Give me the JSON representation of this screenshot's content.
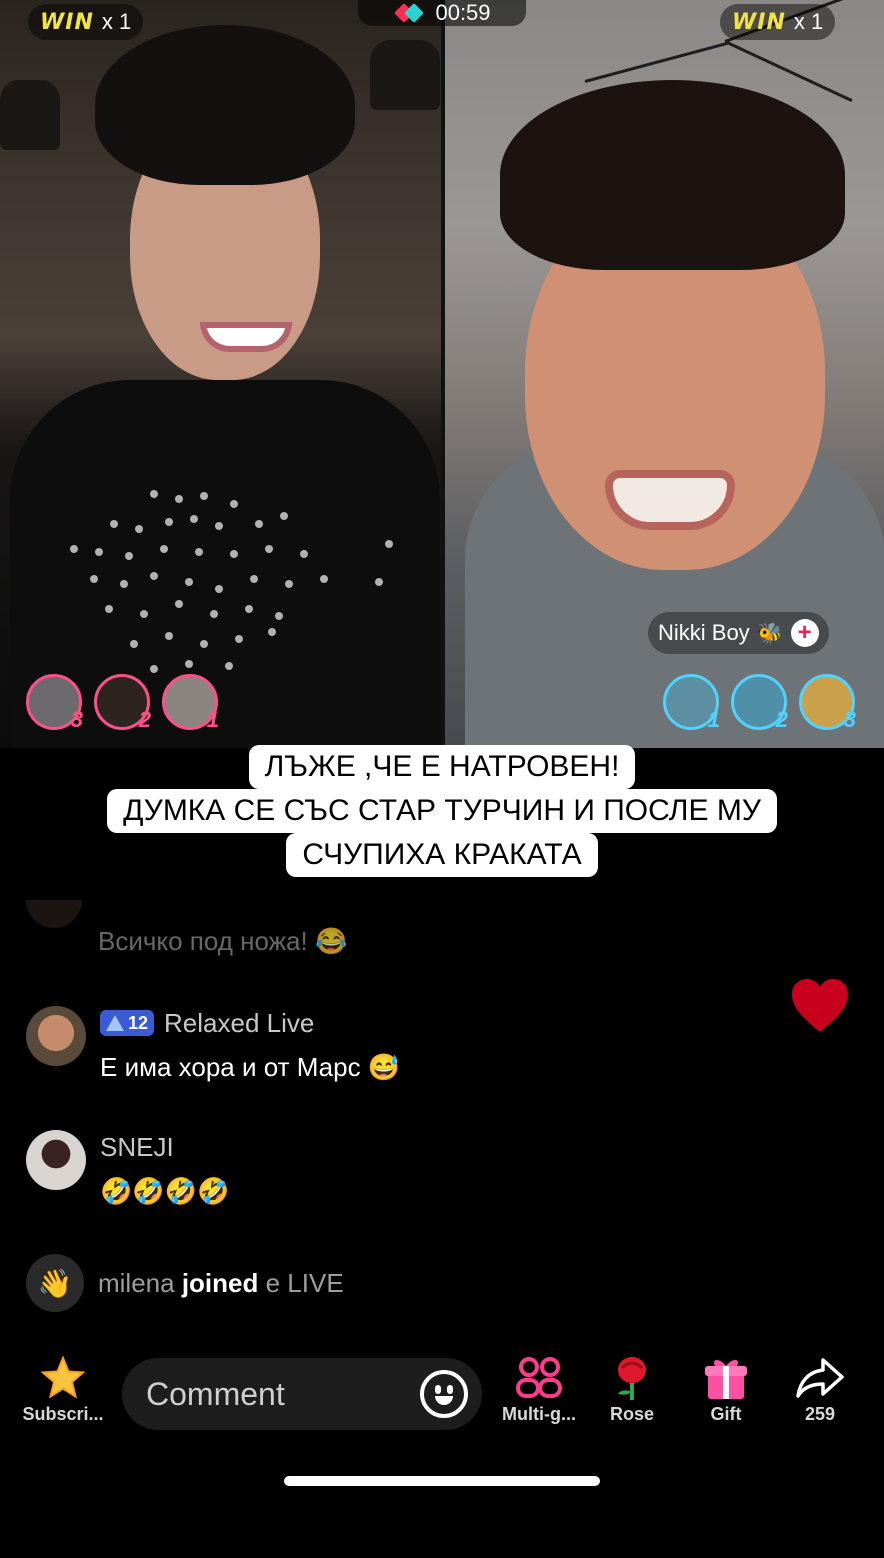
{
  "battle": {
    "timer": "00:59",
    "left": {
      "win_label": "WIN",
      "win_count": "x 1",
      "ranks": [
        "3",
        "2",
        "1"
      ]
    },
    "right": {
      "win_label": "WIN",
      "win_count": "x 1",
      "host_name": "Nikki Boy",
      "host_emoji": "🐝",
      "follow_symbol": "+",
      "ranks": [
        "1",
        "2",
        "3"
      ]
    },
    "left_color": "#ff4f8b",
    "right_color": "#4fd2ff"
  },
  "caption": {
    "lines": [
      "ЛЪЖЕ ,ЧЕ Е НАТРОВЕН!",
      "ДУМКА СЕ СЪС СТАР ТУРЧИН И ПОСЛЕ МУ",
      "СЧУПИХА КРАКАТА"
    ]
  },
  "chat": {
    "faded_message": "Всичко под ножа! 😂",
    "messages": [
      {
        "level": "12",
        "user": "Relaxed Live",
        "text": "Е има хора и от Марс 😅"
      },
      {
        "user": "SNEJI",
        "text": "🤣🤣🤣🤣"
      }
    ],
    "join": {
      "user": "milena",
      "verb": "joined",
      "trailing": "e LIVE"
    }
  },
  "bottom_bar": {
    "subscribe_label": "Subscri...",
    "comment_placeholder": "Comment",
    "multi_guest_label": "Multi-g...",
    "rose_label": "Rose",
    "gift_label": "Gift",
    "share_count": "259"
  },
  "icons": {
    "subscribe": "star-icon",
    "emoji": "smiley-icon",
    "multi_guest": "people-icon",
    "rose": "rose-icon",
    "gift": "gift-icon",
    "share": "share-arrow-icon",
    "heart": "heart-icon"
  }
}
